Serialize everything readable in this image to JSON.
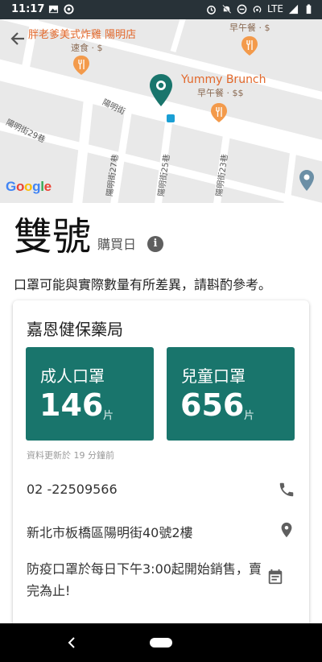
{
  "status_bar": {
    "time": "11:17",
    "network": "LTE"
  },
  "map": {
    "pois": [
      {
        "name": "胖老爹美式炸雞 陽明店",
        "category": "速食 · $"
      },
      {
        "name": "Yummy Brunch",
        "category": "早午餐 · $$"
      },
      {
        "name": "",
        "category": "早午餐 · $"
      }
    ],
    "streets": {
      "yangming": "陽明街",
      "lane29": "陽明街29巷",
      "lane27": "陽明街27巷",
      "lane25": "陽明街25巷",
      "lane23": "陽明街23巷"
    },
    "logo": "Google"
  },
  "header": {
    "title": "雙號",
    "subtitle": "購買日"
  },
  "notice": "口罩可能與實際數量有所差異，請斟酌參考。",
  "pharmacy": {
    "name": "嘉恩健保藥局",
    "adult": {
      "label": "成人口罩",
      "count": "146",
      "unit": "片"
    },
    "child": {
      "label": "兒童口罩",
      "count": "656",
      "unit": "片"
    },
    "updated": "資料更新於 19 分鐘前",
    "phone": "02 -22509566",
    "address": "新北市板橋區陽明街40號2樓",
    "hours": "防疫口罩於每日下午3:00起開始銷售，賣完為止!"
  },
  "colors": {
    "accent": "#19756c",
    "poi_orange": "#e2682b",
    "status_bar": "#283238"
  }
}
